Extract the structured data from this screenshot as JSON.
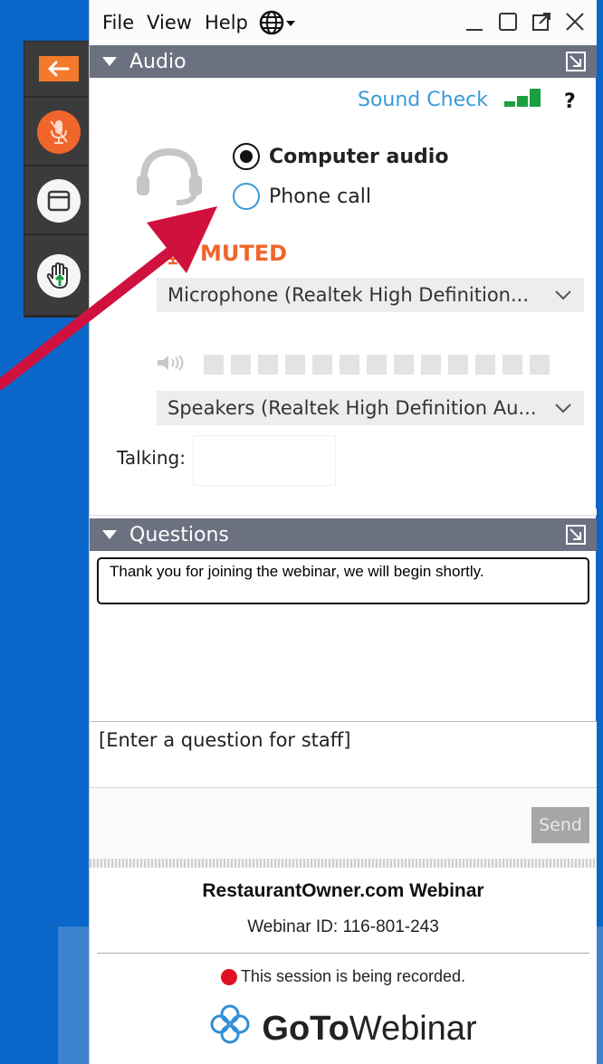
{
  "menu": {
    "file": "File",
    "view": "View",
    "help": "Help"
  },
  "audio": {
    "header": "Audio",
    "sound_check": "Sound Check",
    "help_icon": "?",
    "options": {
      "computer": "Computer audio",
      "phone": "Phone call"
    },
    "selected_option": "computer",
    "mute_status": "MUTED",
    "microphone": "Microphone (Realtek High Definition...",
    "speakers": "Speakers (Realtek High Definition Au...",
    "talking_label": "Talking:"
  },
  "questions": {
    "header": "Questions",
    "message": "Thank you for joining the webinar, we will begin shortly.",
    "input_placeholder": "[Enter a question for staff]",
    "send_label": "Send"
  },
  "webinar": {
    "title": "RestaurantOwner.com Webinar",
    "id_text": "Webinar ID: 116-801-243",
    "recording_notice": "This session is being recorded.",
    "logo_goto": "GoTo",
    "logo_webinar": "Webinar"
  },
  "colors": {
    "background": "#0a66c8",
    "accent_orange": "#f0652b",
    "link_blue": "#3a9ad8",
    "header_gray": "#6b7180",
    "signal_green": "#1aa040",
    "arrow_red": "#d0113d",
    "record_red": "#e01020"
  },
  "icons": [
    "back-arrow-icon",
    "microphone-muted-icon",
    "screen-icon",
    "raise-hand-icon",
    "globe-icon",
    "minimize-icon",
    "maximize-icon",
    "popout-icon",
    "close-icon",
    "headset-icon",
    "speaker-icon",
    "chevron-down-icon",
    "gotowebinar-logo-icon"
  ]
}
